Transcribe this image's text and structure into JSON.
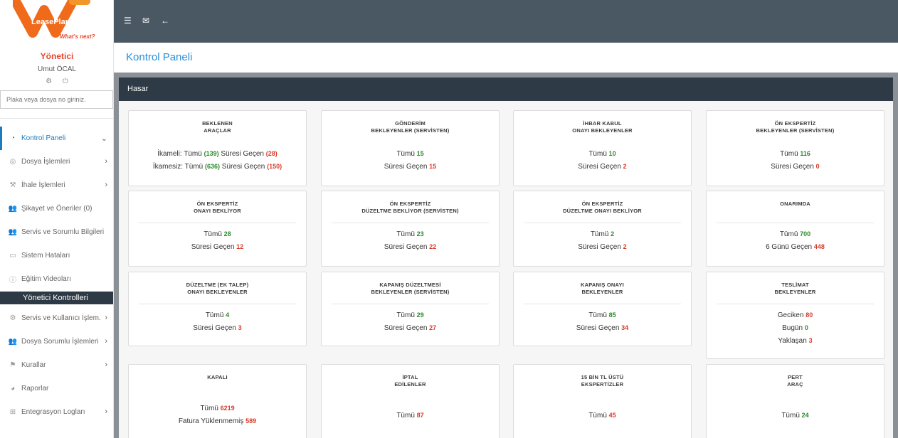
{
  "brand": {
    "name": "LeasePlan",
    "tagline": "What's next?",
    "colors": {
      "orange": "#f06a1b",
      "header": "#4a5864",
      "panel_head": "#2e3b47",
      "accent": "#1f7bbf",
      "green": "#2b8a2b",
      "red": "#d83a2a"
    }
  },
  "user": {
    "role": "Yönetici",
    "name": "Umut ÖCAL",
    "icons": [
      "gear-icon",
      "power-icon"
    ]
  },
  "search": {
    "placeholder": "Plaka veya dosya no giriniz."
  },
  "menu": [
    {
      "label": "Kontrol Paneli",
      "icon": "dashboard-icon",
      "chevron": "⌄",
      "active": true
    },
    {
      "label": "Dosya İşlemleri",
      "icon": "target-icon",
      "chevron": "›"
    },
    {
      "label": "İhale İşlemleri",
      "icon": "gavel-icon",
      "chevron": "›"
    },
    {
      "label": "Şikayet ve Öneriler (0)",
      "icon": "users-icon"
    },
    {
      "label": "Servis ve Sorumlu Bilgileri",
      "icon": "users-icon"
    },
    {
      "label": "Sistem Hataları",
      "icon": "monitor-icon"
    },
    {
      "label": "Eğitim Videoları",
      "icon": "info-icon"
    },
    {
      "label": "Yönetici Kontrolleri",
      "section": true
    },
    {
      "label": "Servis ve Kullanıcı İşlem.",
      "icon": "gear-icon",
      "chevron": "›"
    },
    {
      "label": "Dosya Sorumlu İşlemleri",
      "icon": "user-plus-icon",
      "chevron": "›"
    },
    {
      "label": "Kurallar",
      "icon": "flag-icon",
      "chevron": "›"
    },
    {
      "label": "Raporlar",
      "icon": "pie-chart-icon"
    },
    {
      "label": "Entegrasyon Logları",
      "icon": "sitemap-icon",
      "chevron": "›"
    }
  ],
  "topbar": {
    "icons": [
      "menu-icon",
      "mail-icon",
      "back-arrow-icon"
    ]
  },
  "page": {
    "title": "Kontrol Paneli"
  },
  "panel": {
    "title": "Hasar"
  },
  "cards": [
    {
      "title": [
        "BEKLENEN",
        "ARAÇLAR"
      ],
      "lines": [
        [
          {
            "t": "İkameli: Tümü "
          },
          {
            "t": "(139)",
            "c": "g"
          },
          {
            "t": " Süresi Geçen "
          },
          {
            "t": "(28)",
            "c": "r"
          }
        ],
        [
          {
            "t": "İkamesiz: Tümü "
          },
          {
            "t": "(636)",
            "c": "g"
          },
          {
            "t": " Süresi Geçen "
          },
          {
            "t": "(150)",
            "c": "r"
          }
        ]
      ]
    },
    {
      "title": [
        "GÖNDERİM",
        "BEKLEYENLER (SERVİSTEN)"
      ],
      "lines": [
        [
          {
            "t": "Tümü "
          },
          {
            "t": "15",
            "c": "g"
          }
        ],
        [
          {
            "t": "Süresi Geçen "
          },
          {
            "t": "15",
            "c": "r"
          }
        ]
      ]
    },
    {
      "title": [
        "İHBAR KABUL",
        "ONAYI BEKLEYENLER"
      ],
      "lines": [
        [
          {
            "t": "Tümü "
          },
          {
            "t": "10",
            "c": "g"
          }
        ],
        [
          {
            "t": "Süresi Geçen "
          },
          {
            "t": "2",
            "c": "r"
          }
        ]
      ]
    },
    {
      "title": [
        "ÖN EKSPERTİZ",
        "BEKLEYENLER (SERVİSTEN)"
      ],
      "lines": [
        [
          {
            "t": "Tümü "
          },
          {
            "t": "116",
            "c": "g"
          }
        ],
        [
          {
            "t": "Süresi Geçen "
          },
          {
            "t": "0",
            "c": "r"
          }
        ]
      ]
    },
    {
      "title": [
        "ÖN EKSPERTİZ",
        "ONAYI BEKLİYOR"
      ],
      "lines": [
        [
          {
            "t": "Tümü "
          },
          {
            "t": "28",
            "c": "g"
          }
        ],
        [
          {
            "t": "Süresi Geçen "
          },
          {
            "t": "12",
            "c": "r"
          }
        ]
      ]
    },
    {
      "title": [
        "ÖN EKSPERTİZ",
        "DÜZELTME BEKLİYOR (SERVİSTEN)"
      ],
      "lines": [
        [
          {
            "t": "Tümü "
          },
          {
            "t": "23",
            "c": "g"
          }
        ],
        [
          {
            "t": "Süresi Geçen "
          },
          {
            "t": "22",
            "c": "r"
          }
        ]
      ]
    },
    {
      "title": [
        "ÖN EKSPERTİZ",
        "DÜZELTME ONAYI BEKLİYOR"
      ],
      "lines": [
        [
          {
            "t": "Tümü "
          },
          {
            "t": "2",
            "c": "g"
          }
        ],
        [
          {
            "t": "Süresi Geçen "
          },
          {
            "t": "2",
            "c": "r"
          }
        ]
      ]
    },
    {
      "title": [
        "ONARIMDA"
      ],
      "lines": [
        [
          {
            "t": "Tümü "
          },
          {
            "t": "700",
            "c": "g"
          }
        ],
        [
          {
            "t": "6 Günü Geçen "
          },
          {
            "t": "448",
            "c": "r"
          }
        ]
      ]
    },
    {
      "title": [
        "DÜZELTME (EK TALEP)",
        "ONAYI BEKLEYENLER"
      ],
      "lines": [
        [
          {
            "t": "Tümü "
          },
          {
            "t": "4",
            "c": "g"
          }
        ],
        [
          {
            "t": "Süresi Geçen "
          },
          {
            "t": "3",
            "c": "r"
          }
        ]
      ]
    },
    {
      "title": [
        "KAPANIŞ DÜZELTMESİ",
        "BEKLEYENLER (SERVİSTEN)"
      ],
      "lines": [
        [
          {
            "t": "Tümü "
          },
          {
            "t": "29",
            "c": "g"
          }
        ],
        [
          {
            "t": "Süresi Geçen "
          },
          {
            "t": "27",
            "c": "r"
          }
        ]
      ]
    },
    {
      "title": [
        "KAPANIŞ ONAYI",
        "BEKLEYENLER"
      ],
      "lines": [
        [
          {
            "t": "Tümü "
          },
          {
            "t": "85",
            "c": "g"
          }
        ],
        [
          {
            "t": "Süresi Geçen "
          },
          {
            "t": "34",
            "c": "r"
          }
        ]
      ]
    },
    {
      "title": [
        "TESLİMAT",
        "BEKLEYENLER"
      ],
      "lines": [
        [
          {
            "t": "Geciken "
          },
          {
            "t": "80",
            "c": "r"
          }
        ],
        [
          {
            "t": "Bugün "
          },
          {
            "t": "0",
            "c": "g"
          }
        ],
        [
          {
            "t": "Yaklaşan "
          },
          {
            "t": "3",
            "c": "r"
          }
        ]
      ]
    },
    {
      "title": [
        "KAPALI"
      ],
      "lines": [
        [
          {
            "t": "Tümü "
          },
          {
            "t": "6219",
            "c": "r"
          }
        ],
        [
          {
            "t": "Fatura Yüklenmemiş "
          },
          {
            "t": "589",
            "c": "r"
          }
        ]
      ]
    },
    {
      "title": [
        "İPTAL",
        "EDİLENLER"
      ],
      "lines": [
        [
          {
            "t": "Tümü "
          },
          {
            "t": "87",
            "c": "r"
          }
        ]
      ]
    },
    {
      "title": [
        "15 BİN TL ÜSTÜ",
        "EKSPERTİZLER"
      ],
      "lines": [
        [
          {
            "t": "Tümü "
          },
          {
            "t": "45",
            "c": "r"
          }
        ]
      ]
    },
    {
      "title": [
        "PERT",
        "ARAÇ"
      ],
      "lines": [
        [
          {
            "t": "Tümü "
          },
          {
            "t": "24",
            "c": "g"
          }
        ]
      ]
    }
  ]
}
